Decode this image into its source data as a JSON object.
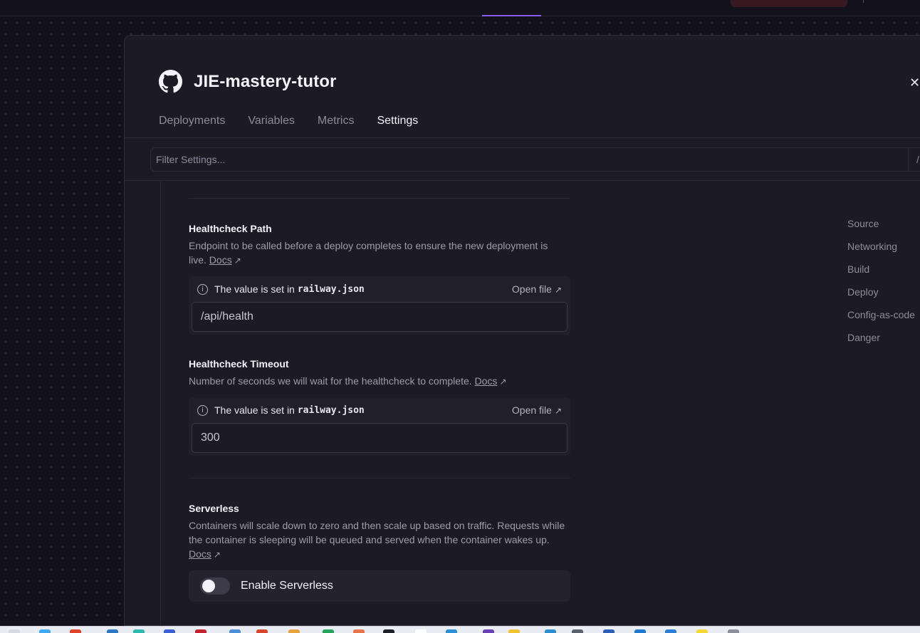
{
  "project": {
    "title": "JIE-mastery-tutor",
    "icon": "github-icon"
  },
  "tabs": [
    {
      "label": "Deployments"
    },
    {
      "label": "Variables"
    },
    {
      "label": "Metrics"
    },
    {
      "label": "Settings",
      "active": true
    }
  ],
  "filter": {
    "placeholder": "Filter Settings...",
    "shortcut": "/"
  },
  "sections": {
    "healthcheck_path": {
      "title": "Healthcheck Path",
      "description": "Endpoint to be called before a deploy completes to ensure the new deployment is live.",
      "docs_label": "Docs",
      "notice_prefix": "The value is set in",
      "notice_file": "railway.json",
      "open_file_label": "Open file",
      "value": "/api/health"
    },
    "healthcheck_timeout": {
      "title": "Healthcheck Timeout",
      "description": "Number of seconds we will wait for the healthcheck to complete.",
      "docs_label": "Docs",
      "notice_prefix": "The value is set in",
      "notice_file": "railway.json",
      "open_file_label": "Open file",
      "value": "300"
    },
    "serverless": {
      "title": "Serverless",
      "description": "Containers will scale down to zero and then scale up based on traffic. Requests while the container is sleeping will be queued and served when the container wakes up.",
      "docs_label": "Docs",
      "toggle_label": "Enable Serverless",
      "enabled": false
    }
  },
  "side_nav": [
    {
      "label": "Source"
    },
    {
      "label": "Networking"
    },
    {
      "label": "Build"
    },
    {
      "label": "Deploy"
    },
    {
      "label": "Config-as-code"
    },
    {
      "label": "Danger"
    }
  ],
  "icons": {
    "close": "close-icon",
    "info": "info-icon",
    "external_link": "external-link-icon"
  },
  "colors": {
    "background": "#13111c",
    "panel": "#1c1a25",
    "accent": "#8b5cf6"
  }
}
